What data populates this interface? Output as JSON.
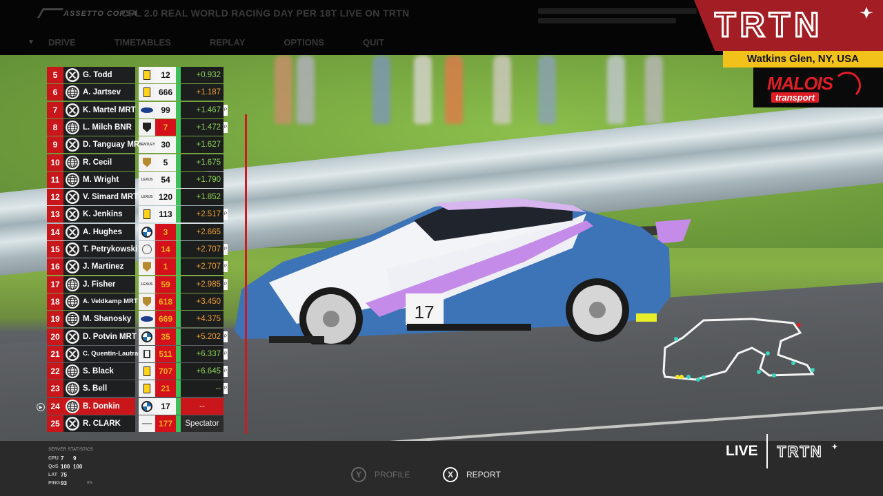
{
  "topbar": {
    "brand": "ASSETTO CORSA",
    "server_title": "CPL 2.0 REAL WORLD RACING DAY PER 18T LIVE ON TRTN",
    "menu": [
      "DRIVE",
      "TIMETABLES",
      "REPLAY",
      "OPTIONS",
      "QUIT"
    ]
  },
  "overlay": {
    "channel_logo": "TRTN",
    "location": "Watkins Glen, NY, USA",
    "sponsor_main": "MALOIS",
    "sponsor_sub": "transport"
  },
  "standings": [
    {
      "pos": "5",
      "platform": "xbox",
      "driver": "G. Todd",
      "brand": "ferrari",
      "number": "12",
      "num_style": "white",
      "gap": "+0.932",
      "gap_color": "green",
      "pit": false
    },
    {
      "pos": "6",
      "platform": "web",
      "driver": "A. Jartsev",
      "brand": "ferrari",
      "number": "666",
      "num_style": "white",
      "gap": "+1.187",
      "gap_color": "orange",
      "pit": false
    },
    {
      "pos": "7",
      "platform": "xbox",
      "driver": "K. Martel MRT",
      "brand": "ford",
      "number": "99",
      "num_style": "white",
      "gap": "+1.467",
      "gap_color": "green",
      "pit": true
    },
    {
      "pos": "8",
      "platform": "web",
      "driver": "L. Milch BNR",
      "brand": "lamborghini",
      "number": "7",
      "num_style": "red",
      "gap": "+1.472",
      "gap_color": "green",
      "pit": true
    },
    {
      "pos": "9",
      "platform": "xbox",
      "driver": "D. Tanguay MRT",
      "brand": "bentley",
      "number": "30",
      "num_style": "white",
      "gap": "+1.627",
      "gap_color": "green",
      "pit": false
    },
    {
      "pos": "10",
      "platform": "web",
      "driver": "R. Cecil",
      "brand": "porsche",
      "number": "5",
      "num_style": "white",
      "gap": "+1.675",
      "gap_color": "green",
      "pit": false
    },
    {
      "pos": "11",
      "platform": "web",
      "driver": "M. Wright",
      "brand": "lexus",
      "number": "54",
      "num_style": "white",
      "gap": "+1.790",
      "gap_color": "green",
      "pit": false
    },
    {
      "pos": "12",
      "platform": "xbox",
      "driver": "V. Simard MRT",
      "brand": "lexus",
      "number": "120",
      "num_style": "white",
      "gap": "+1.852",
      "gap_color": "green",
      "pit": false
    },
    {
      "pos": "13",
      "platform": "xbox",
      "driver": "K. Jenkins",
      "brand": "ferrari",
      "number": "113",
      "num_style": "white",
      "gap": "+2.517",
      "gap_color": "orange",
      "pit": true
    },
    {
      "pos": "14",
      "platform": "xbox",
      "driver": "A. Hughes",
      "brand": "bmw",
      "number": "3",
      "num_style": "red",
      "gap": "+2.665",
      "gap_color": "orange",
      "pit": false
    },
    {
      "pos": "15",
      "platform": "xbox",
      "driver": "T. Petrykowski",
      "brand": "mercedes",
      "number": "14",
      "num_style": "red",
      "gap": "+2.707",
      "gap_color": "orange",
      "pit": true
    },
    {
      "pos": "16",
      "platform": "xbox",
      "driver": "J. Martinez",
      "brand": "porsche",
      "number": "1",
      "num_style": "red",
      "gap": "+2.707",
      "gap_color": "orange",
      "pit": true
    },
    {
      "pos": "17",
      "platform": "web",
      "driver": "J. Fisher",
      "brand": "lexus",
      "number": "59",
      "num_style": "red",
      "gap": "+2.985",
      "gap_color": "orange",
      "pit": true
    },
    {
      "pos": "18",
      "platform": "web",
      "driver": "A. Veldkamp MRT",
      "brand": "porsche",
      "number": "618",
      "num_style": "red",
      "gap": "+3.450",
      "gap_color": "orange",
      "pit": false
    },
    {
      "pos": "19",
      "platform": "web",
      "driver": "M. Shanosky",
      "brand": "ford",
      "number": "669",
      "num_style": "red",
      "gap": "+4.375",
      "gap_color": "orange",
      "pit": false
    },
    {
      "pos": "20",
      "platform": "xbox",
      "driver": "D. Potvin MRT",
      "brand": "bmw",
      "number": "35",
      "num_style": "red",
      "gap": "+5.202",
      "gap_color": "orange",
      "pit": true
    },
    {
      "pos": "21",
      "platform": "xbox",
      "driver": "C. Quentin-Lautram",
      "brand": "honda",
      "number": "511",
      "num_style": "red",
      "gap": "+6.337",
      "gap_color": "green",
      "pit": true
    },
    {
      "pos": "22",
      "platform": "web",
      "driver": "S. Black",
      "brand": "ferrari",
      "number": "707",
      "num_style": "red",
      "gap": "+6.645",
      "gap_color": "green",
      "pit": true
    },
    {
      "pos": "23",
      "platform": "web",
      "driver": "S. Bell",
      "brand": "ferrari",
      "number": "21",
      "num_style": "red",
      "gap": "--",
      "gap_color": "green",
      "pit": true
    },
    {
      "pos": "24",
      "platform": "web",
      "driver": "B. Donkin",
      "brand": "bmw",
      "number": "17",
      "num_style": "white",
      "gap": "--",
      "gap_color": "white",
      "pit": false,
      "self": true
    },
    {
      "pos": "25",
      "platform": "xbox",
      "driver": "R. CLARK",
      "brand": "none",
      "number": "177",
      "num_style": "red",
      "gap": "Spectator",
      "gap_color": "white",
      "pit": false,
      "spectator": true
    }
  ],
  "car_number": "17",
  "server_stats": {
    "title": "SERVER STATISTICS",
    "rows": [
      {
        "label": "CPU",
        "a": "7",
        "b": "9",
        "unit": ""
      },
      {
        "label": "QoS",
        "a": "100",
        "b": "100",
        "unit": ""
      },
      {
        "label": "LAT",
        "a": "75",
        "b": "",
        "unit": ""
      },
      {
        "label": "PING",
        "a": "93",
        "b": "",
        "unit": "ms"
      }
    ]
  },
  "buttons": {
    "profile_glyph": "Y",
    "profile_label": "PROFILE",
    "report_glyph": "X",
    "report_label": "REPORT"
  },
  "live": {
    "label": "LIVE",
    "logo": "TRTN"
  },
  "colors": {
    "accent_red": "#c8161b",
    "brand_red": "#a21d24",
    "brand_yellow": "#f2c21b",
    "gap_green": "#8fd35a",
    "gap_orange": "#f1a23a"
  }
}
